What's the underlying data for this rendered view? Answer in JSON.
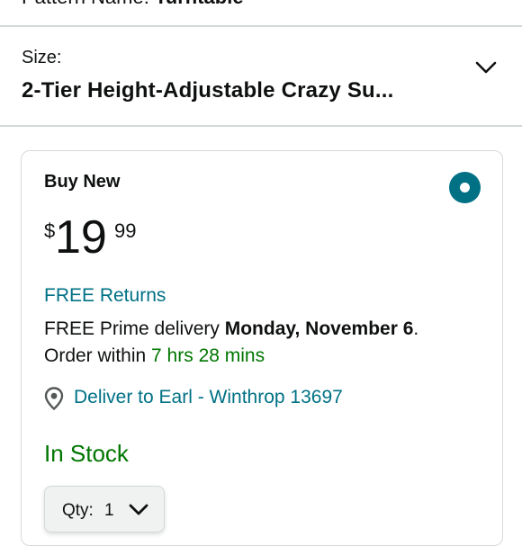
{
  "pattern": {
    "label": "Pattern Name:",
    "value": "Turntable"
  },
  "size": {
    "label": "Size:",
    "value": "2-Tier Height-Adjustable Crazy Su..."
  },
  "offer": {
    "title": "Buy New",
    "price_symbol": "$",
    "price_whole": "19",
    "price_fraction": "99",
    "returns": "FREE Returns",
    "delivery_prefix": "FREE Prime delivery ",
    "delivery_date": "Monday, November 6",
    "delivery_suffix": ".",
    "order_prefix": "Order within ",
    "order_countdown": "7 hrs 28 mins",
    "location": "Deliver to Earl - Winthrop 13697",
    "stock": "In Stock",
    "qty_label": "Qty:",
    "qty_value": "1"
  },
  "colors": {
    "link": "#007185",
    "green": "#007600",
    "divider": "#d5d9d9",
    "radio": "#007185"
  }
}
